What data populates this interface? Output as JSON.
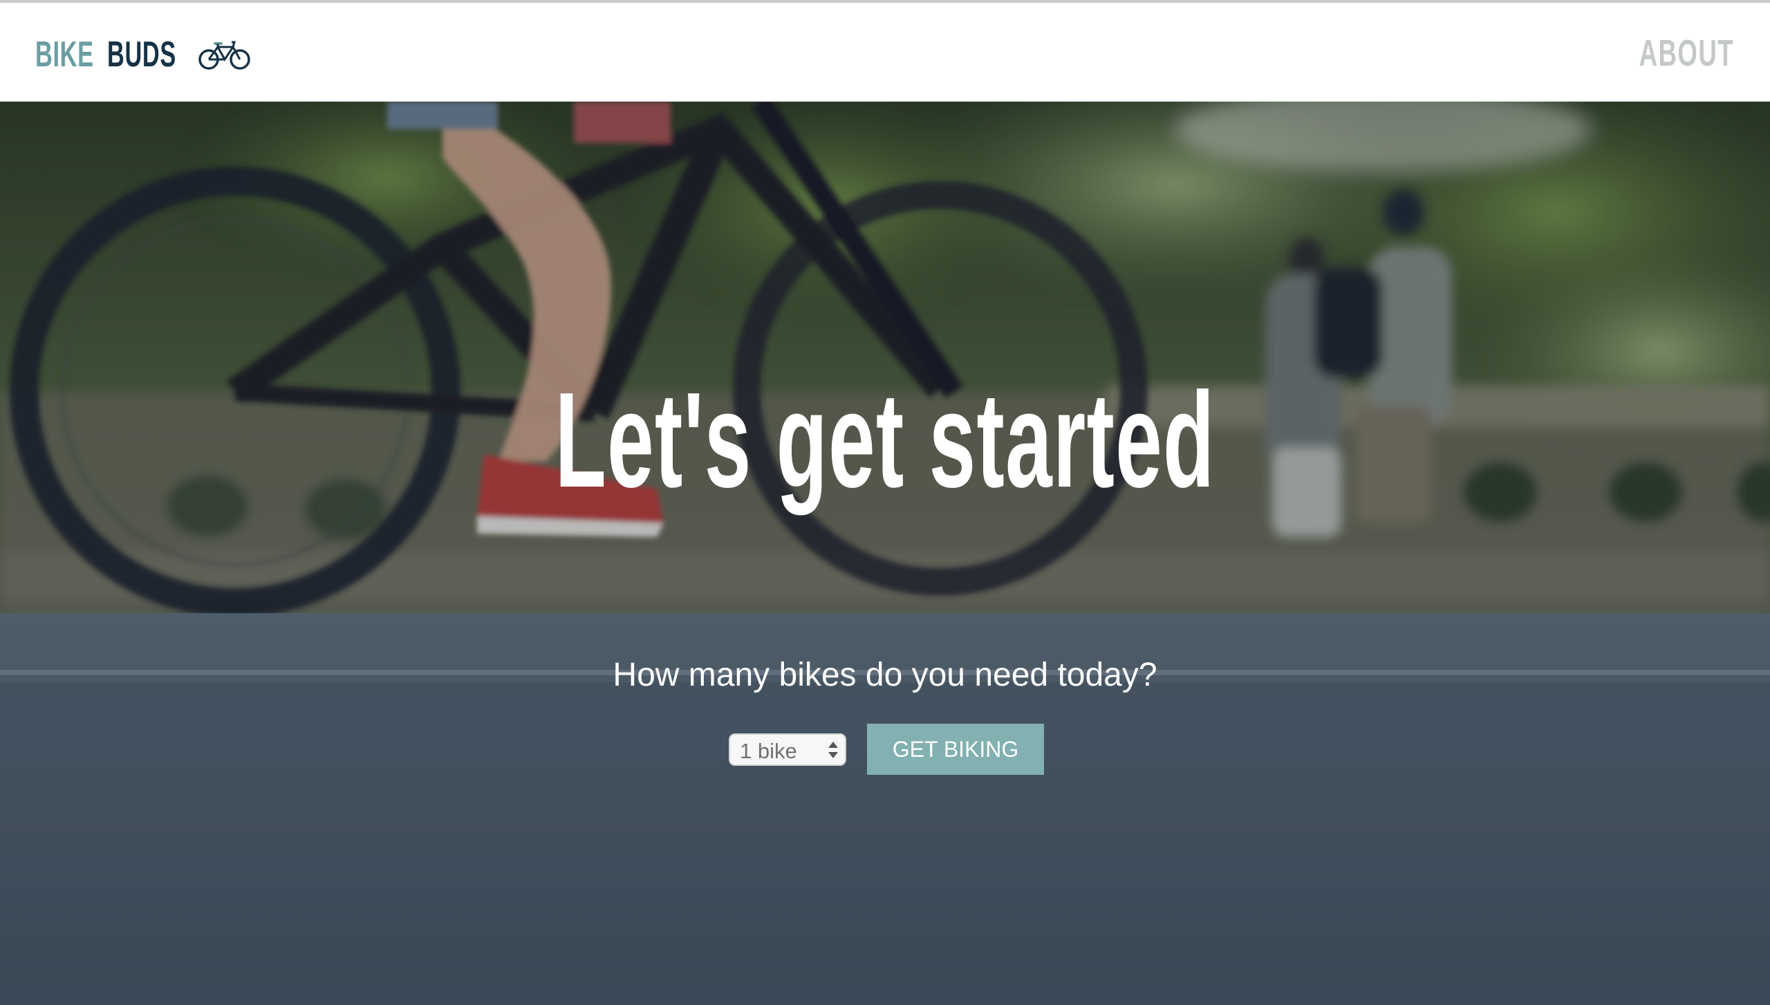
{
  "header": {
    "brand_first": "BIKE",
    "brand_second": "BUDS",
    "brand_icon": "bicycle-icon",
    "nav_about": "ABOUT"
  },
  "hero": {
    "title": "Let's get started",
    "subtitle": "How many bikes do you need today?",
    "bike_count_select": {
      "selected": "1 bike"
    },
    "cta_label": "GET BIKING"
  },
  "colors": {
    "brand_accent": "#6a9ea2",
    "brand_dark": "#163246",
    "nav_muted": "#c5c8c8",
    "button": "#83b0b0"
  }
}
